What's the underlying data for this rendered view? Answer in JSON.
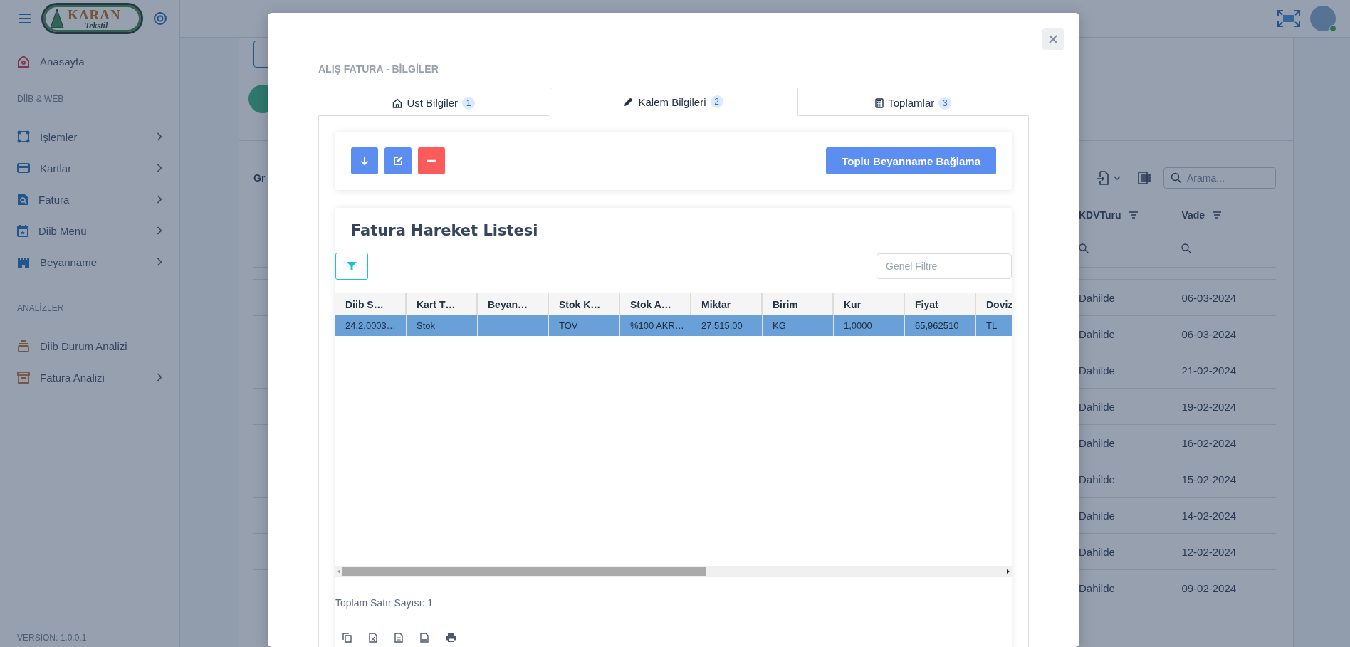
{
  "topbar": {
    "logo": {
      "name": "KARAN",
      "sub": "Tekstil"
    }
  },
  "sidebar": {
    "home": {
      "label": "Anasayfa"
    },
    "sections": [
      {
        "title": "DİİB & WEB",
        "items": [
          {
            "label": "İşlemler",
            "kind": "nodes",
            "has_submenu": true
          },
          {
            "label": "Kartlar",
            "kind": "card",
            "has_submenu": true
          },
          {
            "label": "Fatura",
            "kind": "doc-search",
            "has_submenu": true
          },
          {
            "label": "Diib Menü",
            "kind": "calendar",
            "has_submenu": true
          },
          {
            "label": "Beyanname",
            "kind": "castle",
            "has_submenu": true
          }
        ]
      },
      {
        "title": "ANALİZLER",
        "items": [
          {
            "label": "Diib Durum Analizi",
            "kind": "stack",
            "has_submenu": false
          },
          {
            "label": "Fatura Analizi",
            "kind": "archive",
            "has_submenu": true
          }
        ]
      }
    ],
    "version": "VERSİON: 1.0.0.1"
  },
  "background": {
    "label": "Gr",
    "search": {
      "placeholder": "Arama..."
    },
    "table": {
      "columns": [
        "KDVTuru",
        "Vade"
      ],
      "rows": [
        [
          "Dahilde",
          "06-03-2024"
        ],
        [
          "Dahilde",
          "06-03-2024"
        ],
        [
          "Dahilde",
          "21-02-2024"
        ],
        [
          "Dahilde",
          "19-02-2024"
        ],
        [
          "Dahilde",
          "16-02-2024"
        ],
        [
          "Dahilde",
          "15-02-2024"
        ],
        [
          "Dahilde",
          "14-02-2024"
        ],
        [
          "Dahilde",
          "12-02-2024"
        ],
        [
          "Dahilde",
          "09-02-2024"
        ]
      ]
    }
  },
  "modal": {
    "title": "ALIŞ FATURA - BİLGİLER",
    "tabs": [
      {
        "label": "Üst Bilgiler",
        "badge": "1",
        "kind": "home",
        "selected": false
      },
      {
        "label": "Kalem Bilgileri",
        "badge": "2",
        "kind": "pencil",
        "selected": true
      },
      {
        "label": "Toplamlar",
        "badge": "3",
        "kind": "calculator",
        "selected": false
      }
    ],
    "action_button": "Toplu Beyanname Bağlama",
    "list": {
      "title": "Fatura Hareket Listesi",
      "filter_placeholder": "Genel Filtre",
      "columns": [
        "Diib S…",
        "Kart T…",
        "Beyan…",
        "Stok K…",
        "Stok A…",
        "Miktar",
        "Birim",
        "Kur",
        "Fiyat",
        "Doviz"
      ],
      "rows": [
        {
          "cells": [
            "24.2.0003…",
            "Stok",
            "",
            "TOV",
            "%100 AKR…",
            "27.515,00",
            "KG",
            "1,0000",
            "65,962510",
            "TL"
          ],
          "selected": true
        }
      ],
      "total": "Toplam Satır Sayısı: 1"
    }
  }
}
